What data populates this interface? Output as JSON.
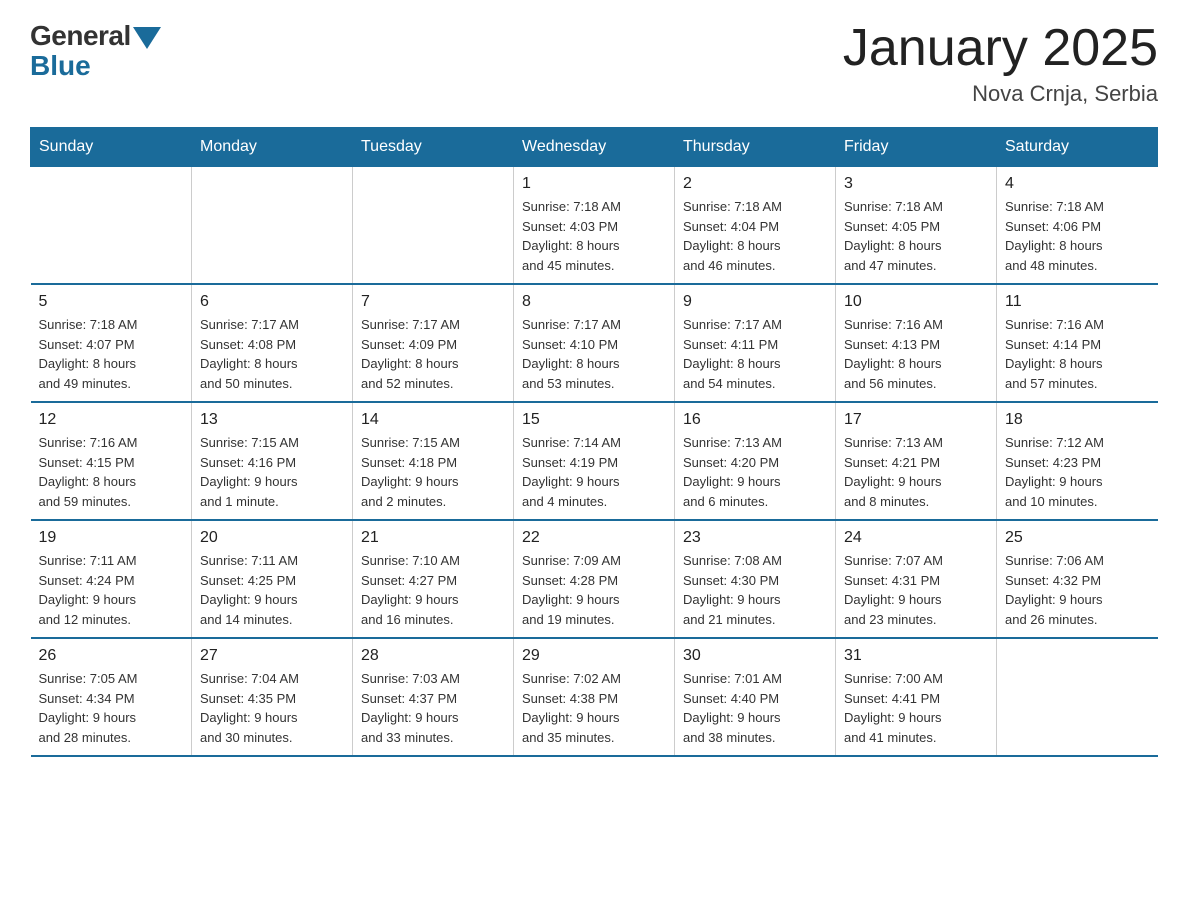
{
  "logo": {
    "general_text": "General",
    "blue_text": "Blue"
  },
  "title": "January 2025",
  "subtitle": "Nova Crnja, Serbia",
  "days_header": [
    "Sunday",
    "Monday",
    "Tuesday",
    "Wednesday",
    "Thursday",
    "Friday",
    "Saturday"
  ],
  "weeks": [
    [
      {
        "day": "",
        "info": ""
      },
      {
        "day": "",
        "info": ""
      },
      {
        "day": "",
        "info": ""
      },
      {
        "day": "1",
        "info": "Sunrise: 7:18 AM\nSunset: 4:03 PM\nDaylight: 8 hours\nand 45 minutes."
      },
      {
        "day": "2",
        "info": "Sunrise: 7:18 AM\nSunset: 4:04 PM\nDaylight: 8 hours\nand 46 minutes."
      },
      {
        "day": "3",
        "info": "Sunrise: 7:18 AM\nSunset: 4:05 PM\nDaylight: 8 hours\nand 47 minutes."
      },
      {
        "day": "4",
        "info": "Sunrise: 7:18 AM\nSunset: 4:06 PM\nDaylight: 8 hours\nand 48 minutes."
      }
    ],
    [
      {
        "day": "5",
        "info": "Sunrise: 7:18 AM\nSunset: 4:07 PM\nDaylight: 8 hours\nand 49 minutes."
      },
      {
        "day": "6",
        "info": "Sunrise: 7:17 AM\nSunset: 4:08 PM\nDaylight: 8 hours\nand 50 minutes."
      },
      {
        "day": "7",
        "info": "Sunrise: 7:17 AM\nSunset: 4:09 PM\nDaylight: 8 hours\nand 52 minutes."
      },
      {
        "day": "8",
        "info": "Sunrise: 7:17 AM\nSunset: 4:10 PM\nDaylight: 8 hours\nand 53 minutes."
      },
      {
        "day": "9",
        "info": "Sunrise: 7:17 AM\nSunset: 4:11 PM\nDaylight: 8 hours\nand 54 minutes."
      },
      {
        "day": "10",
        "info": "Sunrise: 7:16 AM\nSunset: 4:13 PM\nDaylight: 8 hours\nand 56 minutes."
      },
      {
        "day": "11",
        "info": "Sunrise: 7:16 AM\nSunset: 4:14 PM\nDaylight: 8 hours\nand 57 minutes."
      }
    ],
    [
      {
        "day": "12",
        "info": "Sunrise: 7:16 AM\nSunset: 4:15 PM\nDaylight: 8 hours\nand 59 minutes."
      },
      {
        "day": "13",
        "info": "Sunrise: 7:15 AM\nSunset: 4:16 PM\nDaylight: 9 hours\nand 1 minute."
      },
      {
        "day": "14",
        "info": "Sunrise: 7:15 AM\nSunset: 4:18 PM\nDaylight: 9 hours\nand 2 minutes."
      },
      {
        "day": "15",
        "info": "Sunrise: 7:14 AM\nSunset: 4:19 PM\nDaylight: 9 hours\nand 4 minutes."
      },
      {
        "day": "16",
        "info": "Sunrise: 7:13 AM\nSunset: 4:20 PM\nDaylight: 9 hours\nand 6 minutes."
      },
      {
        "day": "17",
        "info": "Sunrise: 7:13 AM\nSunset: 4:21 PM\nDaylight: 9 hours\nand 8 minutes."
      },
      {
        "day": "18",
        "info": "Sunrise: 7:12 AM\nSunset: 4:23 PM\nDaylight: 9 hours\nand 10 minutes."
      }
    ],
    [
      {
        "day": "19",
        "info": "Sunrise: 7:11 AM\nSunset: 4:24 PM\nDaylight: 9 hours\nand 12 minutes."
      },
      {
        "day": "20",
        "info": "Sunrise: 7:11 AM\nSunset: 4:25 PM\nDaylight: 9 hours\nand 14 minutes."
      },
      {
        "day": "21",
        "info": "Sunrise: 7:10 AM\nSunset: 4:27 PM\nDaylight: 9 hours\nand 16 minutes."
      },
      {
        "day": "22",
        "info": "Sunrise: 7:09 AM\nSunset: 4:28 PM\nDaylight: 9 hours\nand 19 minutes."
      },
      {
        "day": "23",
        "info": "Sunrise: 7:08 AM\nSunset: 4:30 PM\nDaylight: 9 hours\nand 21 minutes."
      },
      {
        "day": "24",
        "info": "Sunrise: 7:07 AM\nSunset: 4:31 PM\nDaylight: 9 hours\nand 23 minutes."
      },
      {
        "day": "25",
        "info": "Sunrise: 7:06 AM\nSunset: 4:32 PM\nDaylight: 9 hours\nand 26 minutes."
      }
    ],
    [
      {
        "day": "26",
        "info": "Sunrise: 7:05 AM\nSunset: 4:34 PM\nDaylight: 9 hours\nand 28 minutes."
      },
      {
        "day": "27",
        "info": "Sunrise: 7:04 AM\nSunset: 4:35 PM\nDaylight: 9 hours\nand 30 minutes."
      },
      {
        "day": "28",
        "info": "Sunrise: 7:03 AM\nSunset: 4:37 PM\nDaylight: 9 hours\nand 33 minutes."
      },
      {
        "day": "29",
        "info": "Sunrise: 7:02 AM\nSunset: 4:38 PM\nDaylight: 9 hours\nand 35 minutes."
      },
      {
        "day": "30",
        "info": "Sunrise: 7:01 AM\nSunset: 4:40 PM\nDaylight: 9 hours\nand 38 minutes."
      },
      {
        "day": "31",
        "info": "Sunrise: 7:00 AM\nSunset: 4:41 PM\nDaylight: 9 hours\nand 41 minutes."
      },
      {
        "day": "",
        "info": ""
      }
    ]
  ]
}
